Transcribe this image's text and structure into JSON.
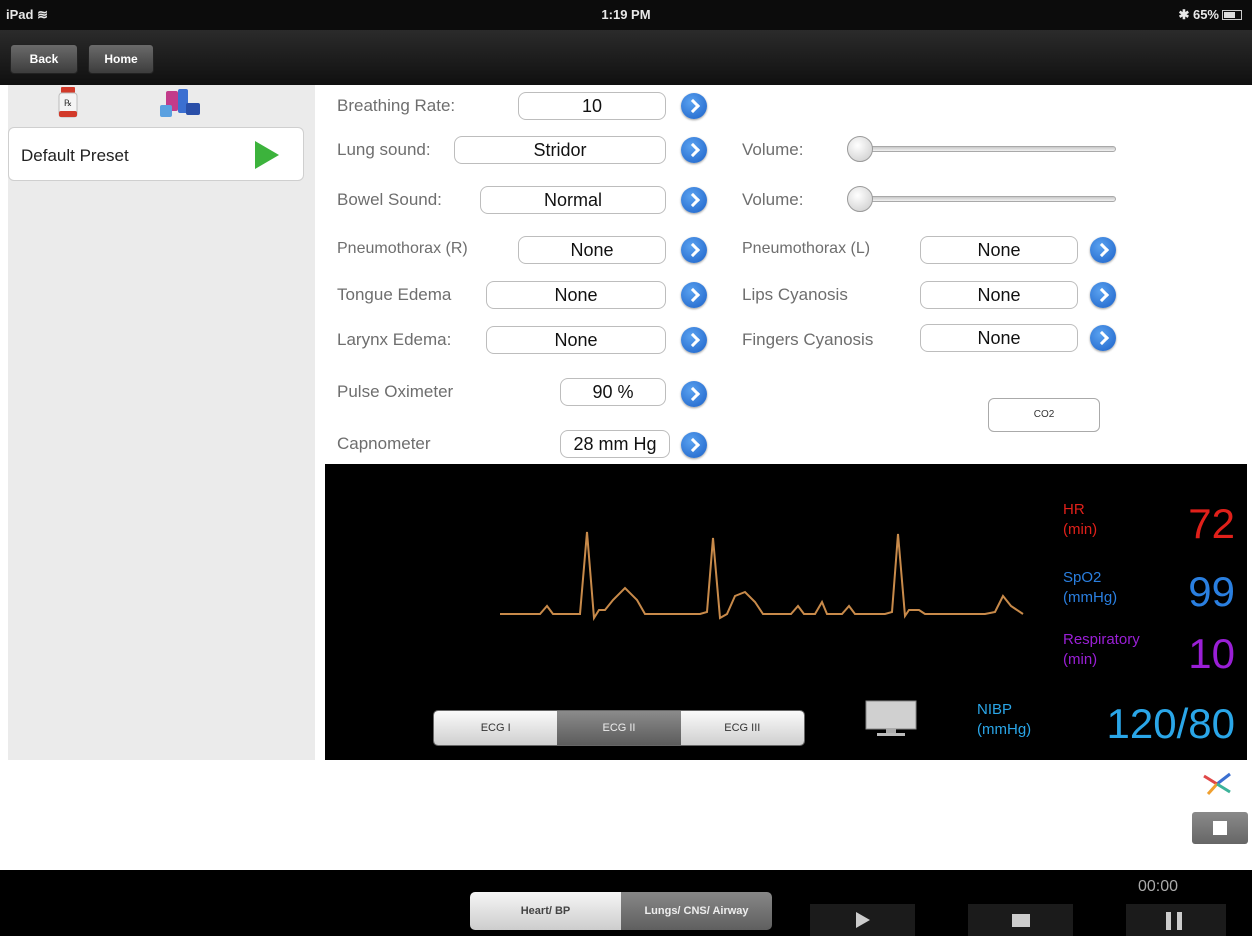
{
  "status": {
    "device": "iPad",
    "time": "1:19 PM",
    "battery": "65%"
  },
  "nav": {
    "back": "Back",
    "home": "Home"
  },
  "sidebar": {
    "preset": "Default Preset"
  },
  "controls": {
    "breathing_rate": {
      "label": "Breathing Rate:",
      "value": "10"
    },
    "lung_sound": {
      "label": "Lung sound:",
      "value": "Stridor"
    },
    "bowel_sound": {
      "label": "Bowel Sound:",
      "value": "Normal"
    },
    "volume_label": "Volume:",
    "lung_volume_level": 0,
    "bowel_volume_level": 0,
    "pneumothorax_r": {
      "label": "Pneumothorax (R)",
      "value": "None"
    },
    "pneumothorax_l": {
      "label": "Pneumothorax (L)",
      "value": "None"
    },
    "tongue_edema": {
      "label": "Tongue Edema",
      "value": "None"
    },
    "lips_cyanosis": {
      "label": "Lips Cyanosis",
      "value": "None"
    },
    "larynx_edema": {
      "label": "Larynx Edema:",
      "value": "None"
    },
    "fingers_cyanosis": {
      "label": "Fingers Cyanosis",
      "value": "None"
    },
    "pulse_oximeter": {
      "label": "Pulse Oximeter",
      "value": "90 %"
    },
    "capnometer": {
      "label": "Capnometer",
      "value": "28 mm Hg"
    },
    "co2_button": "CO2"
  },
  "monitor": {
    "hr": {
      "label1": "HR",
      "label2": "(min)",
      "value": "72",
      "color": "#e0201a"
    },
    "spo2": {
      "label1": "SpO2",
      "label2": "(mmHg)",
      "value": "99",
      "color": "#2a7fe0"
    },
    "resp": {
      "label1": "Respiratory",
      "label2": "(min)",
      "value": "10",
      "color": "#9a1fd6"
    },
    "nibp": {
      "label1": "NIBP",
      "label2": "(mmHg)",
      "value": "120/80",
      "color": "#2aa6e8"
    },
    "ecg_tabs": [
      "ECG I",
      "ECG II",
      "ECG III"
    ],
    "ecg_selected": "ECG II",
    "trace_color": "#c88a4a"
  },
  "bottom": {
    "tab_heart": "Heart/ BP",
    "tab_lungs": "Lungs/ CNS/ Airway",
    "timer": "00:00"
  },
  "icons": [
    "wifi-icon",
    "battery-icon",
    "prescription-bottle-icon",
    "medication-icon",
    "play-icon",
    "disclosure-icon",
    "monitor-screen-icon",
    "pinwheel-logo-icon",
    "stop-icon",
    "pause-icon"
  ]
}
